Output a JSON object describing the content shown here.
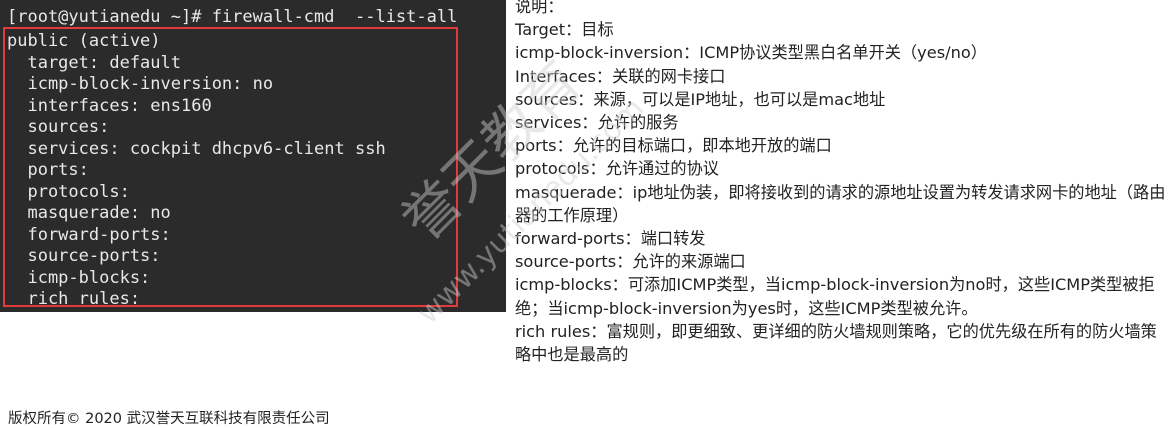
{
  "terminal": {
    "prompt": "[root@yutianedu ~]# firewall-cmd  --list-all",
    "lines": [
      "public (active)",
      "  target: default",
      "  icmp-block-inversion: no",
      "  interfaces: ens160",
      "  sources:",
      "  services: cockpit dhcpv6-client ssh",
      "  ports:",
      "  protocols:",
      "  masquerade: no",
      "  forward-ports:",
      "  source-ports:",
      "  icmp-blocks:",
      "  rich rules:"
    ],
    "highlight_color": "#e23b3b"
  },
  "notes": {
    "title": "说明：",
    "items": [
      "Target：目标",
      "icmp-block-inversion：ICMP协议类型黑白名单开关（yes/no）",
      "Interfaces：关联的网卡接口",
      "sources：来源，可以是IP地址，也可以是mac地址",
      "services：允许的服务",
      "ports：允许的目标端口，即本地开放的端口",
      "protocols：允许通过的协议",
      "masquerade：ip地址伪装，即将接收到的请求的源地址设置为转发请求网卡的地址（路由器的工作原理）",
      "forward-ports：端口转发",
      "source-ports：允许的来源端口",
      "icmp-blocks：可添加ICMP类型，当icmp-block-inversion为no时，这些ICMP类型被拒绝；当icmp-block-inversion为yes时，这些ICMP类型被允许。",
      "rich rules：富规则，即更细致、更详细的防火墙规则策略，它的优先级在所有的防火墙策略中也是最高的"
    ]
  },
  "footer": {
    "copyright": "版权所有© 2020 武汉誉天互联科技有限责任公司"
  },
  "watermark": {
    "brand_text": "誉天教育",
    "url_text": "www.yutianedu.com",
    "color": "#bfbfbf"
  }
}
